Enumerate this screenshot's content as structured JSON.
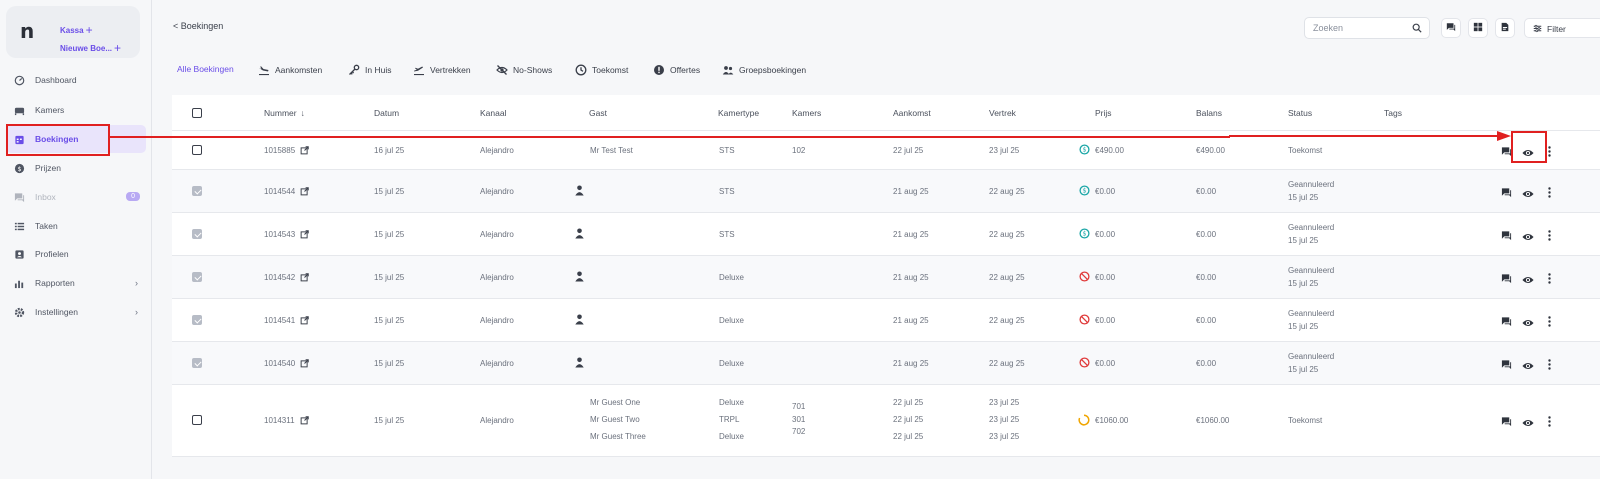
{
  "sidebar": {
    "logo": "n",
    "kassa": "Kassa",
    "nieuwe_boeking": "Nieuwe Boe...",
    "items": [
      {
        "label": "Dashboard"
      },
      {
        "label": "Kamers"
      },
      {
        "label": "Boekingen"
      },
      {
        "label": "Prijzen"
      },
      {
        "label": "Inbox",
        "badge": "0"
      },
      {
        "label": "Taken"
      },
      {
        "label": "Profielen"
      },
      {
        "label": "Rapporten"
      },
      {
        "label": "Instellingen"
      }
    ]
  },
  "topbar": {
    "back": "< Boekingen",
    "search_placeholder": "Zoeken",
    "filter": "Filter"
  },
  "tabs": [
    "Alle Boekingen",
    "Aankomsten",
    "In Huis",
    "Vertrekken",
    "No-Shows",
    "Toekomst",
    "Offertes",
    "Groepsboekingen"
  ],
  "table": {
    "headers": [
      "Nummer",
      "Datum",
      "Kanaal",
      "Gast",
      "Kamertype",
      "Kamers",
      "Aankomst",
      "Vertrek",
      "Prijs",
      "Balans",
      "Status",
      "Tags"
    ],
    "rows": [
      {
        "nummer": "1015885",
        "datum": "16 jul 25",
        "kanaal": "Alejandro",
        "gast": "Mr Test Test",
        "kamertype": "STS",
        "kamers": "102",
        "aankomst": "22 jul 25",
        "vertrek": "23 jul 25",
        "prijs": "€490.00",
        "balans": "€490.00",
        "status": "Toekomst",
        "status_date": ""
      },
      {
        "nummer": "1014544",
        "datum": "15 jul 25",
        "kanaal": "Alejandro",
        "gast": "",
        "kamertype": "STS",
        "kamers": "",
        "aankomst": "21 aug 25",
        "vertrek": "22 aug 25",
        "prijs": "€0.00",
        "balans": "€0.00",
        "status": "Geannuleerd",
        "status_date": "15 jul 25"
      },
      {
        "nummer": "1014543",
        "datum": "15 jul 25",
        "kanaal": "Alejandro",
        "gast": "",
        "kamertype": "STS",
        "kamers": "",
        "aankomst": "21 aug 25",
        "vertrek": "22 aug 25",
        "prijs": "€0.00",
        "balans": "€0.00",
        "status": "Geannuleerd",
        "status_date": "15 jul 25"
      },
      {
        "nummer": "1014542",
        "datum": "15 jul 25",
        "kanaal": "Alejandro",
        "gast": "",
        "kamertype": "Deluxe",
        "kamers": "",
        "aankomst": "21 aug 25",
        "vertrek": "22 aug 25",
        "prijs": "€0.00",
        "balans": "€0.00",
        "status": "Geannuleerd",
        "status_date": "15 jul 25"
      },
      {
        "nummer": "1014541",
        "datum": "15 jul 25",
        "kanaal": "Alejandro",
        "gast": "",
        "kamertype": "Deluxe",
        "kamers": "",
        "aankomst": "21 aug 25",
        "vertrek": "22 aug 25",
        "prijs": "€0.00",
        "balans": "€0.00",
        "status": "Geannuleerd",
        "status_date": "15 jul 25"
      },
      {
        "nummer": "1014540",
        "datum": "15 jul 25",
        "kanaal": "Alejandro",
        "gast": "",
        "kamertype": "Deluxe",
        "kamers": "",
        "aankomst": "21 aug 25",
        "vertrek": "22 aug 25",
        "prijs": "€0.00",
        "balans": "€0.00",
        "status": "Geannuleerd",
        "status_date": "15 jul 25"
      },
      {
        "nummer": "1014311",
        "datum": "15 jul 25",
        "kanaal": "Alejandro",
        "gasten": [
          "Mr Guest One",
          "Mr Guest Two",
          "Mr Guest Three"
        ],
        "kamertypes": [
          "Deluxe",
          "TRPL",
          "Deluxe"
        ],
        "kamers_list": [
          "701",
          "301",
          "702"
        ],
        "aankomsten": [
          "22 jul 25",
          "22 jul 25",
          "22 jul 25"
        ],
        "vertrekken": [
          "23 jul 25",
          "23 jul 25",
          "23 jul 25"
        ],
        "prijs": "€1060.00",
        "balans": "€1060.00",
        "status": "Toekomst"
      }
    ]
  },
  "colors": {
    "accent": "#6a4de8",
    "annotation": "#e02020",
    "paid": "#1aa6a6",
    "cancelled": "#e03a3a",
    "pending": "#f0a500"
  }
}
